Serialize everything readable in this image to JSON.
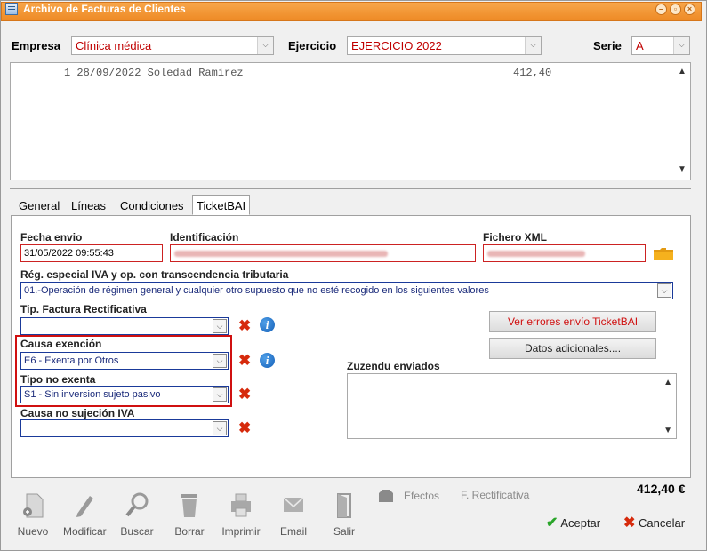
{
  "window": {
    "title": "Archivo de Facturas de Clientes",
    "controls": [
      "minimize",
      "restore",
      "close"
    ]
  },
  "header": {
    "empresa_label": "Empresa",
    "empresa_value": "Clínica médica",
    "ejercicio_label": "Ejercicio",
    "ejercicio_value": "EJERCICIO 2022",
    "serie_label": "Serie",
    "serie_value": "A"
  },
  "listing": {
    "rows": [
      {
        "line": "1 28/09/2022 Soledad Ramírez",
        "amount": "412,40"
      }
    ]
  },
  "tabs": [
    {
      "label": "General",
      "active": false
    },
    {
      "label": "Líneas",
      "active": false
    },
    {
      "label": "Condiciones",
      "active": false
    },
    {
      "label": "TicketBAI",
      "active": true
    }
  ],
  "ticketbai": {
    "fecha_envio_label": "Fecha envio",
    "fecha_envio_value": "31/05/2022 09:55:43",
    "identificacion_label": "Identificación",
    "fichero_xml_label": "Fichero XML",
    "reg_especial_label": "Rég. especial IVA y op. con transcendencia tributaria",
    "reg_especial_value": "01.-Operación de régimen general y cualquier otro supuesto que no esté recogido en los siguientes valores",
    "tip_factura_label": "Tip. Factura Rectificativa",
    "tip_factura_value": "",
    "causa_exencion_label": "Causa exención",
    "causa_exencion_value": "E6 - Exenta por Otros",
    "tipo_no_exenta_label": "Tipo no exenta",
    "tipo_no_exenta_value": "S1 - Sin inversion sujeto pasivo",
    "causa_no_sujecion_label": "Causa no sujeción IVA",
    "causa_no_sujecion_value": "",
    "ver_errores_button": "Ver errores envío TicketBAI",
    "datos_adicionales_button": "Datos adicionales....",
    "zuzendu_label": "Zuzendu enviados"
  },
  "toolbar": {
    "nuevo": "Nuevo",
    "modificar": "Modificar",
    "buscar": "Buscar",
    "borrar": "Borrar",
    "imprimir": "Imprimir",
    "email": "Email",
    "salir": "Salir",
    "efectos": "Efectos",
    "rectificativa": "F. Rectificativa"
  },
  "footer": {
    "total": "412,40 €",
    "aceptar": "Aceptar",
    "cancelar": "Cancelar"
  },
  "colors": {
    "titlebar": "#f09530",
    "accent_red": "#d01010",
    "value_red": "#c00000",
    "dropdown_border": "#1a3a9a"
  }
}
